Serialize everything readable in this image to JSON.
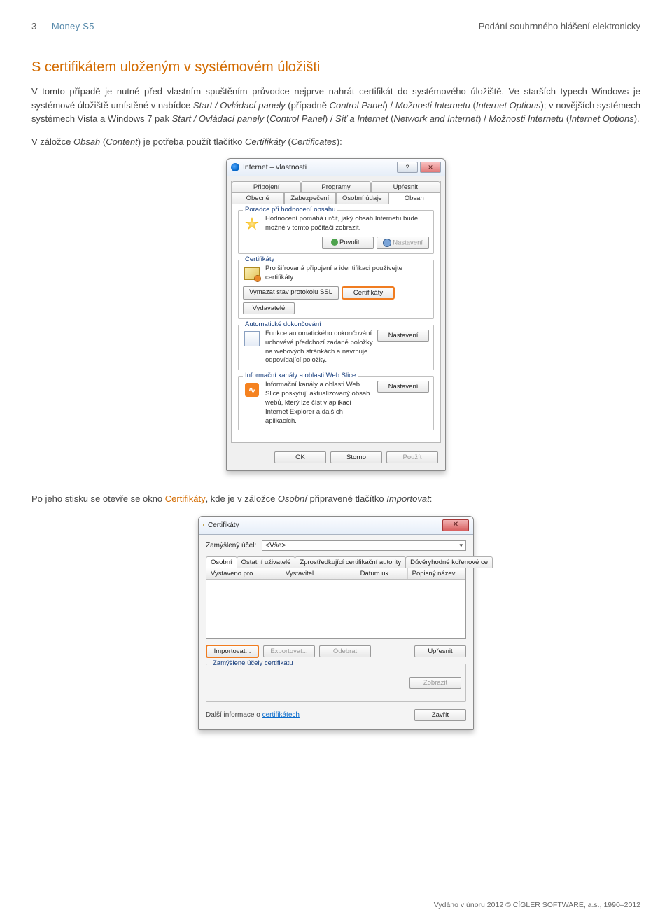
{
  "header": {
    "page_number": "3",
    "brand": "Money S5",
    "doc_title": "Podání souhrnného hlášení elektronicky"
  },
  "article": {
    "heading": "S certifikátem uloženým v systémovém úložišti",
    "para1_prefix": "V tomto případě je nutné před vlastním spuštěním průvodce nejprve nahrát certifikát do systémového úložiště. Ve starších typech Windows je systémové úložiště umístěné v nabídce ",
    "para1_i1": "Start / Ovládací panely",
    "para1_mid1": " (případně ",
    "para1_i2": "Control Panel",
    "para1_mid2": ") / ",
    "para1_i3": "Možnosti Internetu",
    "para1_mid3": " (",
    "para1_i4": "Internet Options",
    "para1_mid4": "); v novějších systémech systémech Vista a Windows 7 pak ",
    "para1_i5": "Start / Ovládací panely",
    "para1_mid5": " (",
    "para1_i6": "Control Panel",
    "para1_mid6": ") / ",
    "para1_i7": "Síť a Internet",
    "para1_mid7": " (",
    "para1_i8": "Network and Internet",
    "para1_mid8": ") / ",
    "para1_i9": "Možnosti Internetu",
    "para1_mid9": " (",
    "para1_i10": "Internet Options",
    "para1_end": ").",
    "para2_prefix": "V záložce ",
    "para2_i1": "Obsah",
    "para2_mid1": " (",
    "para2_i2": "Content",
    "para2_mid2": ") je potřeba použít tlačítko ",
    "para2_i3": "Certifikáty",
    "para2_mid3": " (",
    "para2_i4": "Certificates",
    "para2_end": "):",
    "para3_prefix": "Po jeho stisku se otevře se okno ",
    "certlink": "Certifikáty",
    "para3_mid": ", kde je v záložce ",
    "para3_i1": "Osobní",
    "para3_mid2": " připravené tlačítko ",
    "para3_i2": "Importovat",
    "para3_end": ":"
  },
  "dialog1": {
    "title": "Internet – vlastnosti",
    "tabs_top": [
      "Připojení",
      "Programy",
      "Upřesnit"
    ],
    "tabs_bottom": [
      "Obecné",
      "Zabezpečení",
      "Osobní údaje",
      "Obsah"
    ],
    "group_rating": {
      "legend": "Poradce při hodnocení obsahu",
      "desc": "Hodnocení pomáhá určit, jaký obsah Internetu bude možné v tomto počítači zobrazit.",
      "btn_enable": "Povolit...",
      "btn_settings": "Nastavení"
    },
    "group_cert": {
      "legend": "Certifikáty",
      "desc": "Pro šifrovaná připojení a identifikaci používejte certifikáty.",
      "btn_clear_ssl": "Vymazat stav protokolu SSL",
      "btn_cert": "Certifikáty",
      "btn_pub": "Vydavatelé"
    },
    "group_autocomplete": {
      "legend": "Automatické dokončování",
      "desc": "Funkce automatického dokončování uchovává předchozí zadané položky na webových stránkách a navrhuje odpovídající položky.",
      "btn_settings": "Nastavení"
    },
    "group_feeds": {
      "legend": "Informační kanály a oblasti Web Slice",
      "desc": "Informační kanály a oblasti Web Slice poskytují aktualizovaný obsah webů, který lze číst v aplikaci Internet Explorer a dalších aplikacích.",
      "btn_settings": "Nastavení"
    },
    "footer": {
      "ok": "OK",
      "cancel": "Storno",
      "apply": "Použít"
    }
  },
  "dialog2": {
    "title": "Certifikáty",
    "purpose_label": "Zamýšlený účel:",
    "purpose_value": "<Vše>",
    "tabs": [
      "Osobní",
      "Ostatní uživatelé",
      "Zprostředkující certifikační autority",
      "Důvěryhodné kořenové ce"
    ],
    "columns": [
      "Vystaveno pro",
      "Vystavitel",
      "Datum uk...",
      "Popisný název"
    ],
    "btn_import": "Importovat...",
    "btn_export": "Exportovat...",
    "btn_remove": "Odebrat",
    "btn_detail": "Upřesnit",
    "purposes_legend": "Zamýšlené účely certifikátu",
    "btn_view": "Zobrazit",
    "more_info_prefix": "Další informace o ",
    "more_info_link": "certifikátech",
    "btn_close": "Zavřít"
  },
  "footer": {
    "text": "Vydáno v únoru 2012 © CÍGLER SOFTWARE, a.s., 1990–2012"
  }
}
